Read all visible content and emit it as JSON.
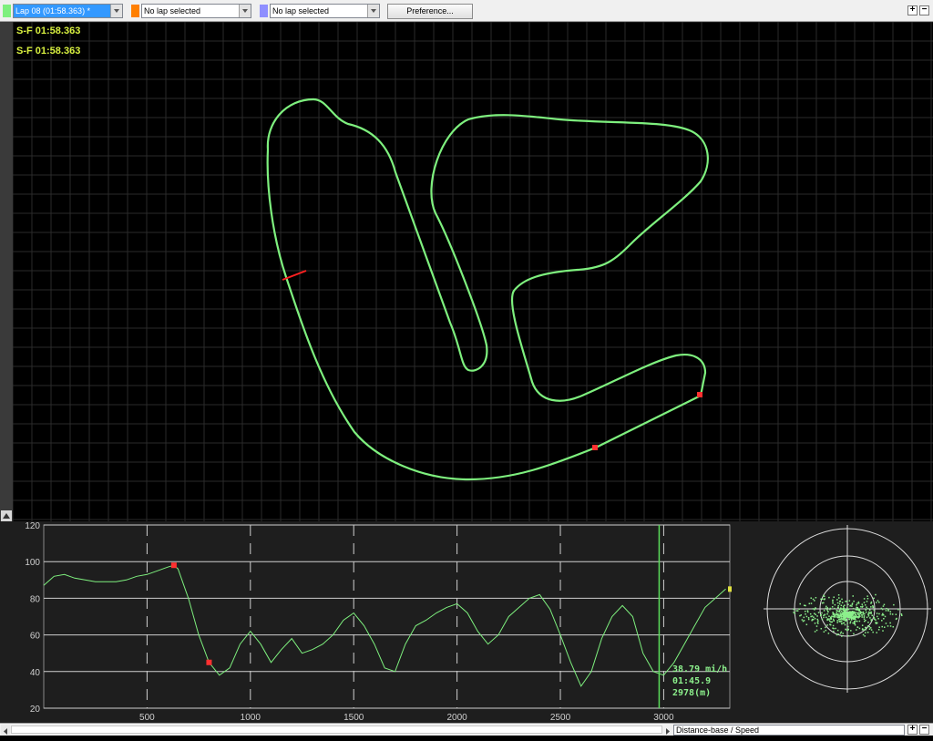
{
  "toolbar": {
    "lap1": {
      "label": "Lap 08   (01:58.363) *",
      "color": "#7ef07e"
    },
    "lap2": {
      "label": "No lap selected",
      "color": "#ff7f00"
    },
    "lap3": {
      "label": "No lap selected",
      "color": "#8f8fff"
    },
    "preference_label": "Preference...",
    "zoom_in": "+",
    "zoom_out": "−"
  },
  "map": {
    "sf_labels": [
      "S-F 01:58.363",
      "S-F 01:58.363"
    ],
    "track_color": "#7ef07e",
    "marker_color": "#ff3030",
    "start_line_color": "#ff2020"
  },
  "graph": {
    "y_ticks": [
      "120",
      "100",
      "80",
      "60",
      "40",
      "20"
    ],
    "x_ticks": [
      "500",
      "1000",
      "1500",
      "2000",
      "2500",
      "3000"
    ],
    "readout": {
      "speed": "38.79 mi/h",
      "time": "01:45.9",
      "distance": "2978(m)"
    }
  },
  "chart_data": {
    "type": "line",
    "x": [
      0,
      50,
      100,
      150,
      200,
      250,
      300,
      350,
      400,
      450,
      500,
      550,
      600,
      630,
      650,
      700,
      750,
      800,
      850,
      900,
      950,
      1000,
      1050,
      1100,
      1150,
      1200,
      1250,
      1300,
      1350,
      1400,
      1450,
      1500,
      1550,
      1600,
      1650,
      1700,
      1750,
      1800,
      1850,
      1900,
      1950,
      2000,
      2050,
      2100,
      2150,
      2200,
      2250,
      2300,
      2350,
      2400,
      2450,
      2500,
      2550,
      2600,
      2650,
      2700,
      2750,
      2800,
      2850,
      2900,
      2950,
      3000,
      3050,
      3100,
      3150,
      3200,
      3300
    ],
    "series": [
      {
        "values": [
          87,
          92,
          93,
          91,
          90,
          89,
          89,
          89,
          90,
          92,
          93,
          95,
          97,
          98,
          96,
          80,
          60,
          45,
          38,
          42,
          55,
          62,
          55,
          45,
          52,
          58,
          50,
          52,
          55,
          60,
          68,
          72,
          65,
          55,
          42,
          40,
          55,
          65,
          68,
          72,
          75,
          77,
          72,
          62,
          55,
          60,
          70,
          75,
          80,
          82,
          74,
          60,
          45,
          32,
          40,
          58,
          70,
          76,
          70,
          50,
          40,
          38,
          45,
          55,
          65,
          75,
          85
        ]
      }
    ],
    "xlim": [
      0,
      3320
    ],
    "ylim": [
      20,
      120
    ],
    "grid": true,
    "cursor_x": 2978
  },
  "gg_plot": {
    "rings": 3
  }
}
